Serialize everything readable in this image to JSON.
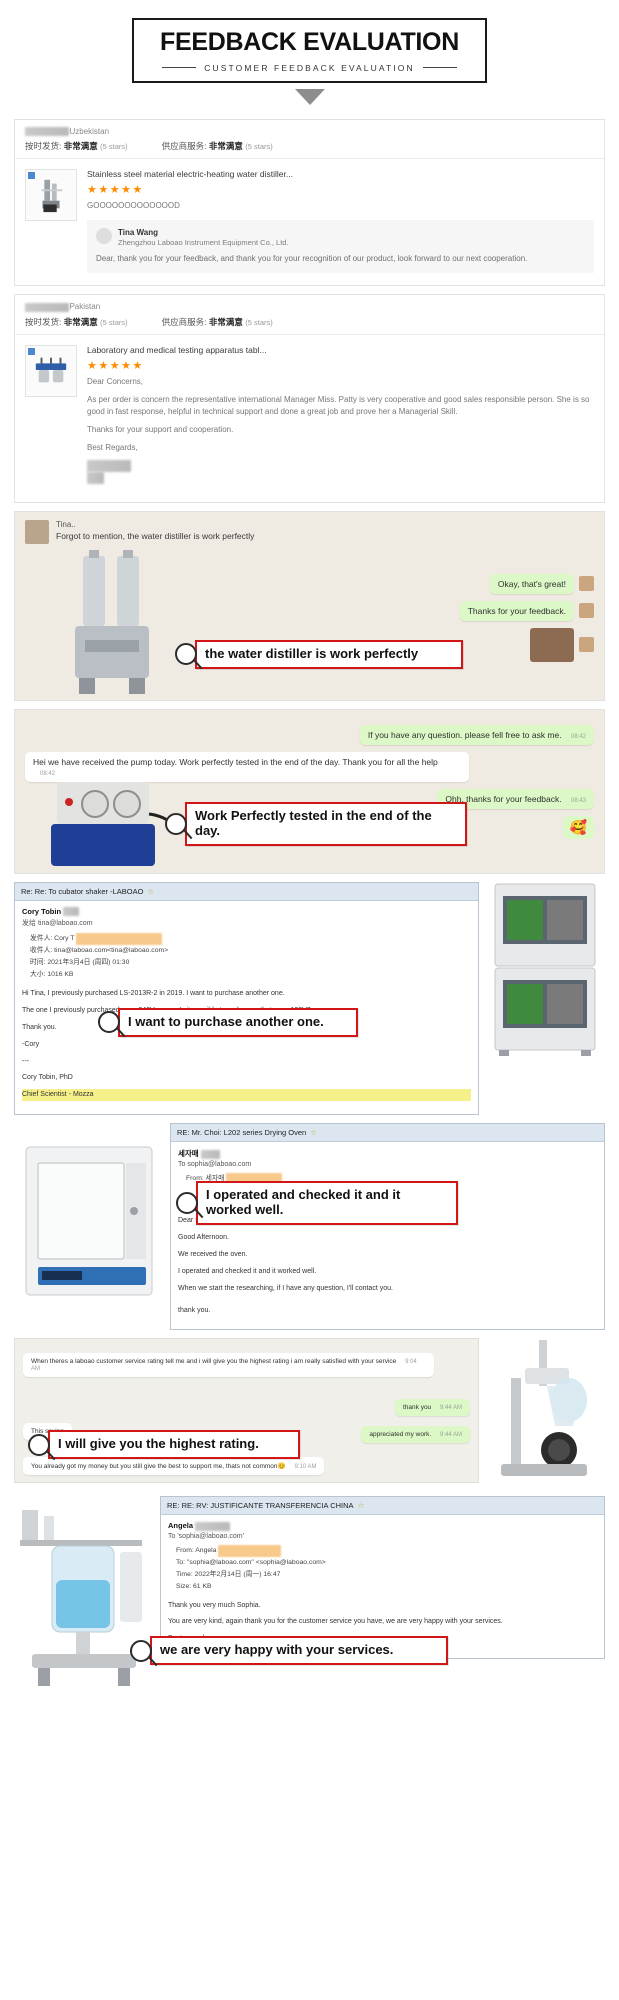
{
  "header": {
    "title": "FEEDBACK EVALUATION",
    "subtitle": "CUSTOMER FEEDBACK EVALUATION"
  },
  "feedback_cards": [
    {
      "buyer_country": "Uzbekistan",
      "rating_rows": [
        {
          "label": "按时发货:",
          "value": "非常满意",
          "stars": "(5 stars)"
        },
        {
          "label": "供应商服务:",
          "value": "非常满意",
          "stars": "(5 stars)"
        }
      ],
      "product": "Stainless steel material electric-heating water distiller...",
      "stars": "★★★★★",
      "comment": "GOOOOOOOOOOOOOD",
      "reply": {
        "name": "Tina Wang",
        "company": "Zhengzhou Laboao Instrument Equipment Co., Ltd.",
        "text": "Dear, thank you for your feedback, and thank you for your recognition of  our product, look forward to our next cooperation."
      }
    },
    {
      "buyer_country": "Pakistan",
      "rating_rows": [
        {
          "label": "按时发货:",
          "value": "非常满意",
          "stars": "(5 stars)"
        },
        {
          "label": "供应商服务:",
          "value": "非常满意",
          "stars": "(5 stars)"
        }
      ],
      "product": "Laboratory and medical testing apparatus tabl...",
      "stars": "★★★★★",
      "comment_lines": [
        "Dear Concerns,",
        "As per order is concern the representative international Manager Miss. Patty is very cooperative and good sales responsible person. She is so good in fast response, helpful in technical support and done a great job and prove her a Managerial Skill.",
        "Thanks for your support and cooperation.",
        "Best Regards,"
      ]
    }
  ],
  "chat1": {
    "contact_name": "Tina..",
    "first_line": "Forgot to mention, the water distiller is work perfectly",
    "bubbles": [
      {
        "text": "Okay, that's great!",
        "side": "right"
      },
      {
        "text": "Thanks for your feedback.",
        "side": "right"
      }
    ],
    "callout": "the water distiller is work perfectly"
  },
  "chat2": {
    "bubbles": [
      {
        "text": "If you have any question. please fell free to ask me.",
        "side": "right",
        "time": "08:42"
      },
      {
        "text": "Hei we have received the pump today. Work perfectly tested in the end of the day. Thank you for all the help",
        "side": "left",
        "time": "08:42"
      },
      {
        "text": "Ohh. thanks for your feedback.",
        "side": "right",
        "time": "08:43"
      }
    ],
    "emoji": "🥰",
    "callout": "Work Perfectly tested in the end of the day."
  },
  "email1": {
    "title": "Re: Re: To  cubator shaker -LABOAO",
    "from_name": "Cory Tobin",
    "sent_to": "发给 tina@laboao.com",
    "meta": [
      "发件人: Cory T",
      "收件人: tina@laboao.com<tina@laboao.com>",
      "时间: 2021年3月4日 (周四) 01:30",
      "大小: 1016 KB"
    ],
    "body": [
      "Hi Tina,  I previously purchased LS-2013R-2 in 2019. I want to purchase another one.",
      "The one I previously purchased uses 240V power.  Is it possible to make one that uses 120V?",
      "Thank you.",
      "-Cory",
      "---",
      "Cory Tobin, PhD",
      "Chief Scientist - Mozza"
    ],
    "callout": "I want to purchase another one."
  },
  "email2": {
    "title": "RE: Mr. Choi: L202 series Drying Oven",
    "from_name": "세자매",
    "sent_to": "To sophia@laboao.com",
    "from_line": "From: 세자매",
    "body": [
      "Dear Sophia,",
      "Good Afternoon.",
      "We received the oven.",
      "I operated and checked it and it worked well.",
      "When we start the researching, if I have any question, I'll contact you.",
      "thank you."
    ],
    "callout": "I operated and checked it and it worked well."
  },
  "chat3": {
    "bubbles": [
      {
        "text": "When theres a laboao  customer service rating tell me and i will give you the highest rating i am really satisfied with your service",
        "side": "left",
        "time": "9:04 AM"
      },
      {
        "text": "thank you",
        "side": "right",
        "time": "9:44 AM"
      },
      {
        "text": "This saying",
        "side": "left",
        "time": ""
      },
      {
        "text": "appreciated my work.",
        "side": "right",
        "time": "9:44 AM"
      },
      {
        "text": "You already got my money but you still give the best to support me, thats not common😊",
        "side": "left",
        "time": "9:10 AM"
      }
    ],
    "callout": "I will give you the highest rating."
  },
  "email3": {
    "title": "RE: RE: RV: JUSTIFICANTE TRANSFERENCIA CHINA",
    "from_name": "Angela",
    "sent_to": "To 'sophia@laboao.com'",
    "meta": [
      "From: Angela",
      "To: \"sophia@laboao.com\" <sophia@laboao.com>",
      "Time: 2022年2月14日 (周一) 16:47",
      "Size: 61 KB"
    ],
    "body": [
      "Thank you very much Sophia.",
      "You are very kind, again thank you for the customer service you have, we are very happy with your services.",
      "Best regards"
    ],
    "callout": "we are very happy with your services."
  },
  "colors": {
    "accent_red": "#d21616",
    "star_orange": "#ff8a00",
    "chat_green": "#dcf8c6"
  }
}
